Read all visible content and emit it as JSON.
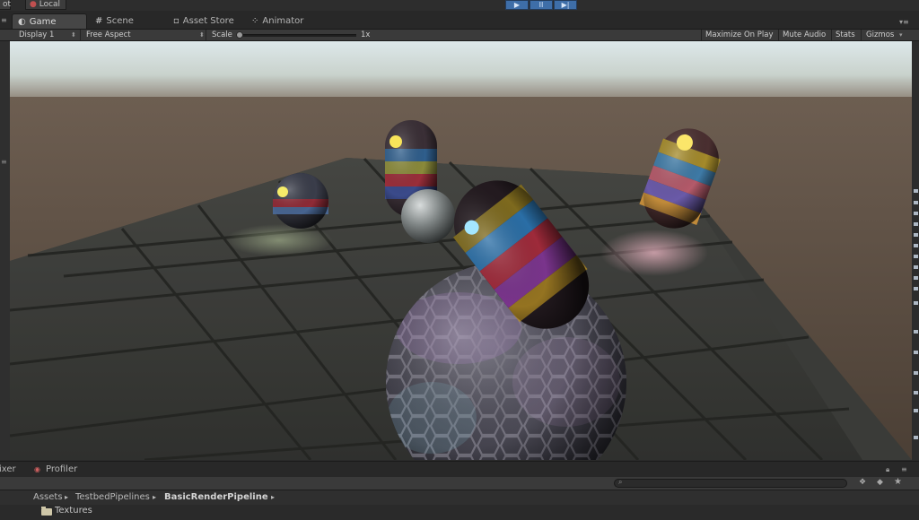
{
  "top_strip": {
    "left_chip_1": "ot",
    "left_chip_2": "Local",
    "play_glyph": "▶",
    "pause_glyph": "II",
    "step_glyph": "▶|"
  },
  "tabs": [
    {
      "label": "Game",
      "icon": "game-controller-icon",
      "active": true
    },
    {
      "label": "Scene",
      "icon": "grid-icon",
      "active": false
    },
    {
      "label": "Asset Store",
      "icon": "bag-icon",
      "active": false
    },
    {
      "label": "Animator",
      "icon": "animator-icon",
      "active": false
    }
  ],
  "game_toolbar": {
    "display": "Display 1",
    "aspect": "Free Aspect",
    "scale_label": "Scale",
    "scale_value": "1x",
    "scale_slider_level": 0,
    "maximize_on_play": "Maximize On Play",
    "mute_audio": "Mute Audio",
    "stats": "Stats",
    "gizmos": "Gizmos"
  },
  "bottom_tabs": [
    {
      "label": "ixer"
    },
    {
      "label": "Profiler",
      "icon": "profiler-icon"
    }
  ],
  "breadcrumb": [
    "Assets",
    "TestbedPipelines",
    "BasicRenderPipeline"
  ],
  "breadcrumb_sep": "▸",
  "files": [
    {
      "label": "Textures",
      "icon": "folder-icon"
    }
  ],
  "colors": {
    "play_active": "#3e6ea8",
    "sky_top": "#dfe9ec",
    "ground": "#5a4b3f",
    "floor": "#3d3f3c"
  }
}
